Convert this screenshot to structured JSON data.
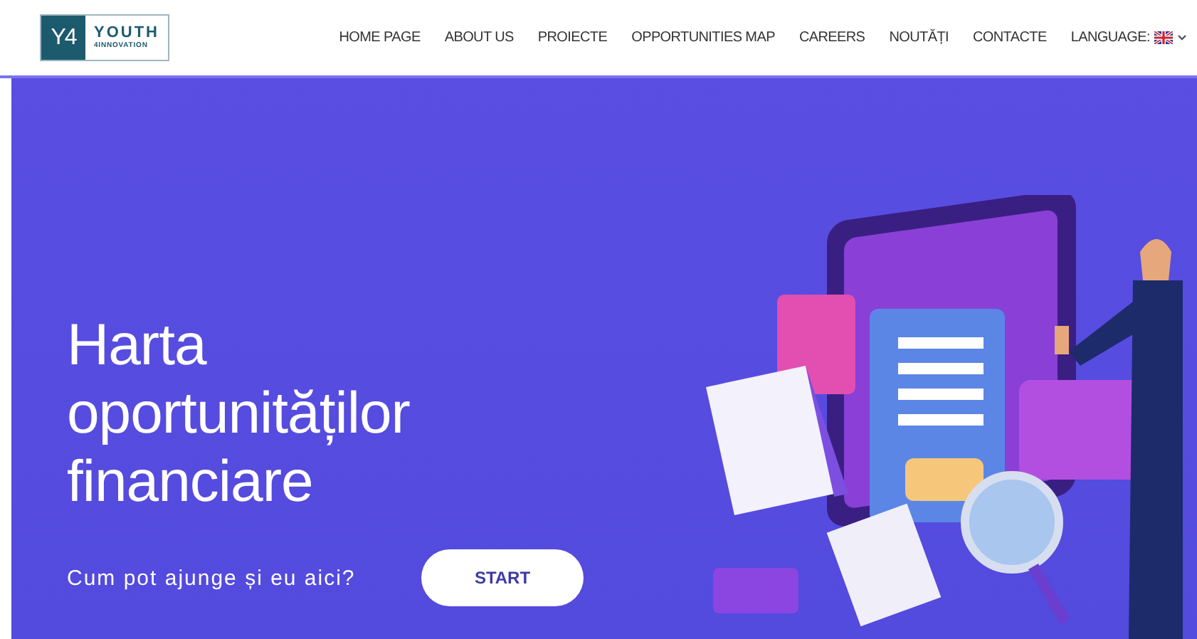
{
  "logo": {
    "mark": "Y4",
    "name": "YOUTH",
    "tagline": "4INNOVATION"
  },
  "nav": [
    {
      "label": "HOME PAGE"
    },
    {
      "label": "ABOUT US"
    },
    {
      "label": "PROIECTE"
    },
    {
      "label": "OPPORTUNITIES MAP"
    },
    {
      "label": "CAREERS"
    },
    {
      "label": "NOUTĂȚI"
    },
    {
      "label": "CONTACTE"
    }
  ],
  "language": {
    "label": "LANGUAGE:"
  },
  "hero": {
    "title_lines": [
      "Harta",
      "oportunităților",
      "financiare"
    ],
    "subtitle": "Cum pot ajunge și eu aici?",
    "button": "START"
  }
}
